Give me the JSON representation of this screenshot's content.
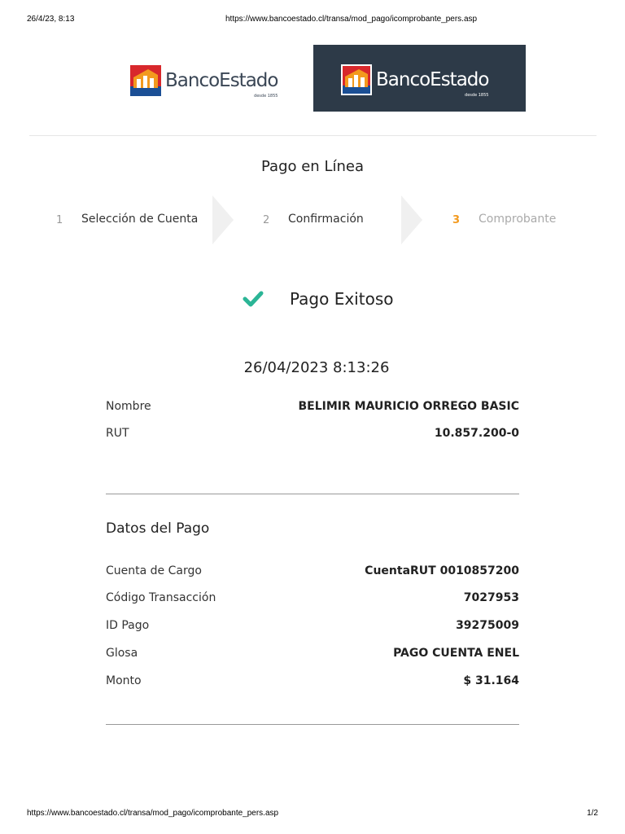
{
  "print_header": {
    "datetime": "26/4/23, 8:13",
    "url": "https://www.bancoestado.cl/transa/mod_pago/icomprobante_pers.asp"
  },
  "print_footer": {
    "url": "https://www.bancoestado.cl/transa/mod_pago/icomprobante_pers.asp",
    "page": "1/2"
  },
  "brand": {
    "name": "BancoEstado",
    "tagline": "desde 1855",
    "dark_bg": "#2d3a48",
    "logo_red": "#d8282c",
    "logo_blue": "#1b4f95",
    "logo_orange": "#f39a1e"
  },
  "page_title": "Pago en Línea",
  "steps": [
    {
      "num": "1",
      "label": "Selección de Cuenta",
      "state": "done"
    },
    {
      "num": "2",
      "label": "Confirmación",
      "state": "done"
    },
    {
      "num": "3",
      "label": "Comprobante",
      "state": "active"
    }
  ],
  "status": {
    "icon": "check-icon",
    "text": "Pago Exitoso",
    "color": "#2bb596"
  },
  "timestamp": "26/04/2023 8:13:26",
  "client": {
    "name_label": "Nombre",
    "name_value": "BELIMIR MAURICIO ORREGO BASIC",
    "rut_label": "RUT",
    "rut_value": "10.857.200-0"
  },
  "payment": {
    "title": "Datos del Pago",
    "rows": [
      {
        "label": "Cuenta de Cargo",
        "value": "CuentaRUT 0010857200"
      },
      {
        "label": "Código Transacción",
        "value": "7027953"
      },
      {
        "label": "ID Pago",
        "value": "39275009"
      },
      {
        "label": "Glosa",
        "value": "PAGO CUENTA ENEL"
      },
      {
        "label": "Monto",
        "value": "$ 31.164"
      }
    ]
  }
}
